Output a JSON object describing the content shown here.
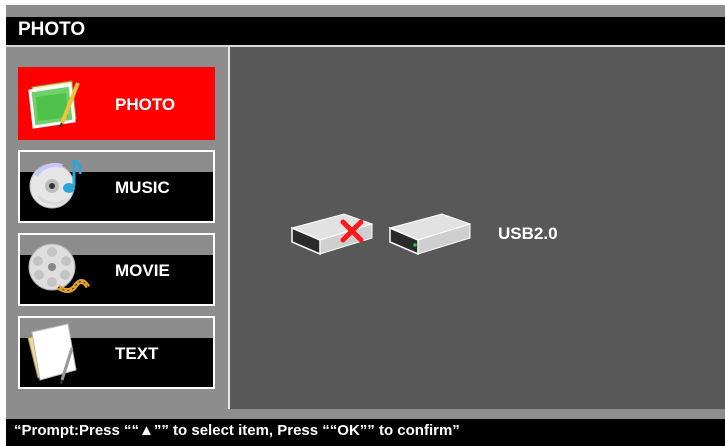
{
  "header": {
    "title": "PHOTO"
  },
  "sidebar": {
    "items": [
      {
        "label": "PHOTO",
        "icon": "photo-icon",
        "active": true
      },
      {
        "label": "MUSIC",
        "icon": "music-cd-icon",
        "active": false
      },
      {
        "label": "MOVIE",
        "icon": "film-reel-icon",
        "active": false
      },
      {
        "label": "TEXT",
        "icon": "text-document-icon",
        "active": false
      }
    ]
  },
  "main": {
    "devices": [
      {
        "icon": "drive-disconnected-icon",
        "status": "unavailable"
      },
      {
        "icon": "usb-drive-icon",
        "label": "USB2.0",
        "status": "available"
      }
    ]
  },
  "footer": {
    "prompt": "“Prompt:Press ““▲”” to select item, Press ““OK”” to confirm”"
  },
  "colors": {
    "active": "#ff0000",
    "frame": "#8d8d8d",
    "panel": "#585858",
    "bar": "#000000",
    "text": "#ffffff"
  }
}
